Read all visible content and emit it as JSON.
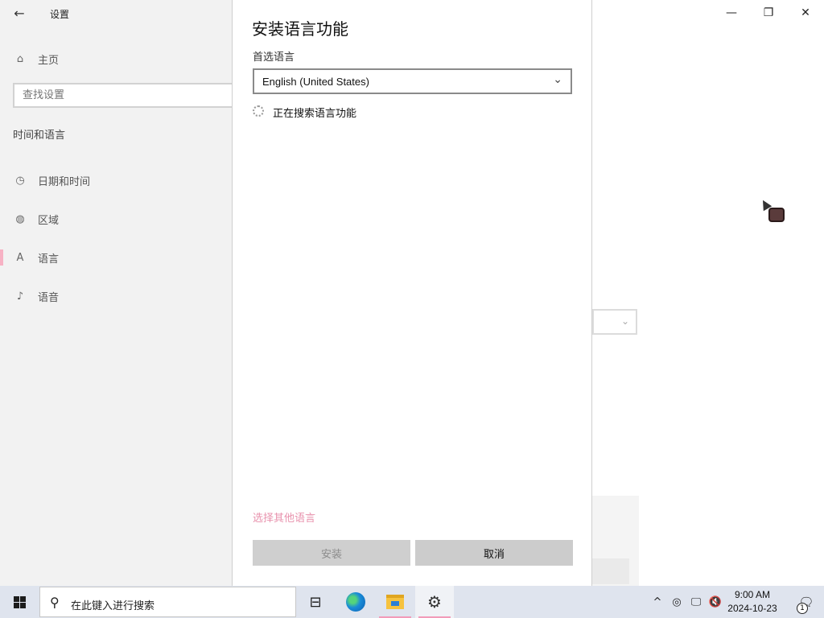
{
  "window": {
    "title": "设置",
    "controls": {
      "minimize": "—",
      "restore": "❐",
      "close": "✕"
    }
  },
  "sidebar": {
    "back_icon": "←",
    "home": {
      "icon": "⌂",
      "label": "主页"
    },
    "search_placeholder": "查找设置",
    "section_title": "时间和语言",
    "items": [
      {
        "icon": "◷",
        "label": "日期和时间"
      },
      {
        "icon": "◍",
        "label": "区域"
      },
      {
        "icon": "A",
        "label": "语言"
      },
      {
        "icon": "♪",
        "label": "语音"
      }
    ]
  },
  "dialog": {
    "title": "安装语言功能",
    "preferred_label": "首选语言",
    "selected_language": "English (United States)",
    "dropdown_chevron": "⌄",
    "searching_text": "正在搜索语言功能",
    "other_language_link": "选择其他语言",
    "install_button": "安装",
    "cancel_button": "取消"
  },
  "taskbar": {
    "search_placeholder": "在此键入进行搜索",
    "search_icon": "⚲",
    "taskview_icon": "⊟",
    "settings_icon": "⚙",
    "tray": {
      "chevron": "^",
      "meet_icon": "◎",
      "network_icon": "🖵",
      "volume_icon": "🔇"
    },
    "time": "9:00 AM",
    "date": "2024-10-23",
    "notification_icon": "🗨",
    "notification_count": "1"
  },
  "colors": {
    "accent_pink": "#e892ad",
    "taskbar_bg": "#dfe4ee",
    "sidebar_bg": "#f2f2f2"
  }
}
